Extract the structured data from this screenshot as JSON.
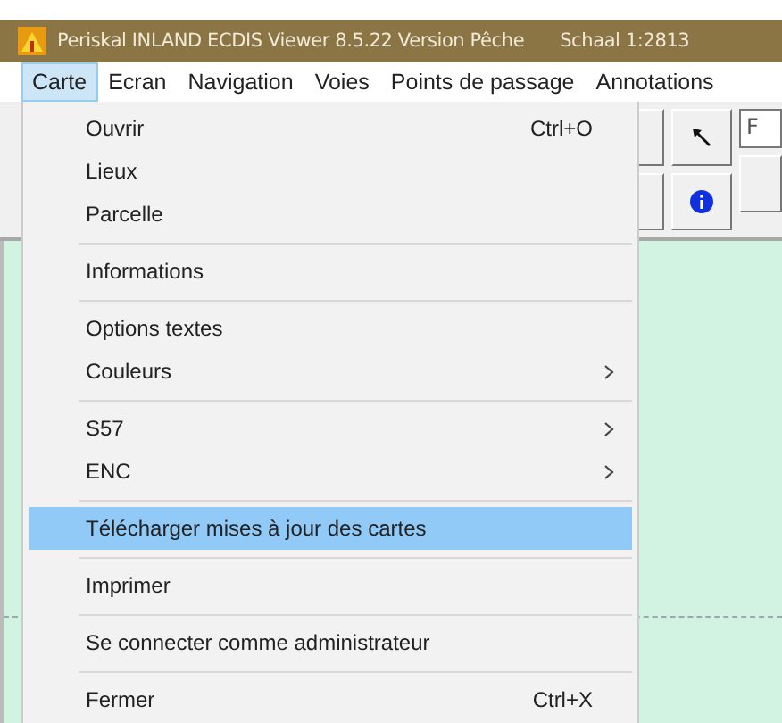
{
  "window": {
    "title": "Periskal INLAND ECDIS Viewer 8.5.22  Version Pêche",
    "scale": "Schaal 1:2813"
  },
  "menubar": [
    {
      "label": "Carte",
      "selected": true
    },
    {
      "label": "Ecran",
      "selected": false
    },
    {
      "label": "Navigation",
      "selected": false
    },
    {
      "label": "Voies",
      "selected": false
    },
    {
      "label": "Points de passage",
      "selected": false
    },
    {
      "label": "Annotations",
      "selected": false
    }
  ],
  "dropdown": [
    {
      "kind": "item",
      "label": "Ouvrir",
      "shortcut": "Ctrl+O",
      "submenu": false,
      "selected": false
    },
    {
      "kind": "item",
      "label": "Lieux",
      "submenu": false,
      "selected": false
    },
    {
      "kind": "item",
      "label": "Parcelle",
      "submenu": false,
      "selected": false
    },
    {
      "kind": "separator"
    },
    {
      "kind": "item",
      "label": "Informations",
      "submenu": false,
      "selected": false
    },
    {
      "kind": "separator"
    },
    {
      "kind": "item",
      "label": "Options textes",
      "submenu": false,
      "selected": false
    },
    {
      "kind": "item",
      "label": "Couleurs",
      "submenu": true,
      "selected": false
    },
    {
      "kind": "separator"
    },
    {
      "kind": "item",
      "label": "S57",
      "submenu": true,
      "selected": false
    },
    {
      "kind": "item",
      "label": "ENC",
      "submenu": true,
      "selected": false
    },
    {
      "kind": "separator"
    },
    {
      "kind": "item",
      "label": "Télécharger mises à jour des cartes",
      "submenu": false,
      "selected": true
    },
    {
      "kind": "separator"
    },
    {
      "kind": "item",
      "label": "Imprimer",
      "submenu": false,
      "selected": false
    },
    {
      "kind": "separator"
    },
    {
      "kind": "item",
      "label": "Se connecter comme administrateur",
      "submenu": false,
      "selected": false
    },
    {
      "kind": "separator"
    },
    {
      "kind": "item",
      "label": "Fermer",
      "shortcut": "Ctrl+X",
      "submenu": false,
      "selected": false
    }
  ],
  "toolbar": {
    "field_value": "F"
  }
}
